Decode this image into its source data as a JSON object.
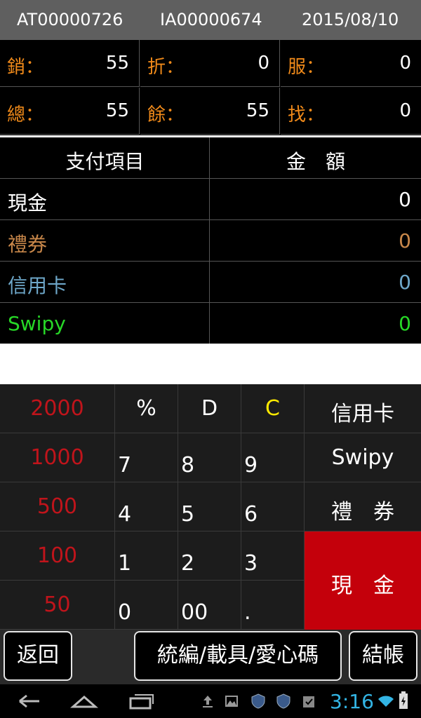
{
  "header": {
    "account_id": "AT00000726",
    "invoice_id": "IA00000674",
    "date": "2015/08/10"
  },
  "summary": [
    {
      "label": "銷：",
      "value": "55"
    },
    {
      "label": "折：",
      "value": "0"
    },
    {
      "label": "服：",
      "value": "0"
    },
    {
      "label": "總：",
      "value": "55"
    },
    {
      "label": "餘：",
      "value": "55"
    },
    {
      "label": "找：",
      "value": "0"
    }
  ],
  "payments": {
    "header_item": "支付項目",
    "header_amount": "金　額",
    "rows": [
      {
        "label": "現金",
        "amount": "0",
        "color": "#ffffff"
      },
      {
        "label": "禮券",
        "amount": "0",
        "color": "#c8874a"
      },
      {
        "label": "信用卡",
        "amount": "0",
        "color": "#6ea7c9"
      },
      {
        "label": "Swipy",
        "amount": "0",
        "color": "#27d827"
      }
    ]
  },
  "keypad": {
    "denominations": [
      "2000",
      "1000",
      "500",
      "100",
      "50"
    ],
    "functions": [
      "%",
      "D",
      "C"
    ],
    "digits": [
      "7",
      "8",
      "9",
      "4",
      "5",
      "6",
      "1",
      "2",
      "3",
      "0",
      "00",
      "."
    ],
    "payment_types": [
      "信用卡",
      "Swipy",
      "禮　券",
      "現　金"
    ]
  },
  "actions": {
    "back": "返回",
    "carrier": "統編/載具/愛心碼",
    "checkout": "結帳"
  },
  "status": {
    "time": "3:16"
  }
}
